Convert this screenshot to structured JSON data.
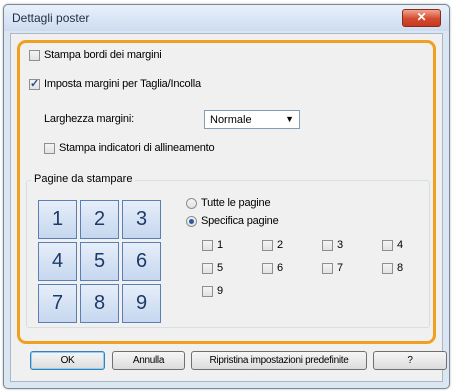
{
  "window": {
    "title": "Dettagli poster",
    "close_label": "✕"
  },
  "options": {
    "print_border_label": "Stampa bordi dei margini",
    "print_border_checked": false,
    "set_margins_label": "Imposta margini per Taglia/Incolla",
    "set_margins_checked": true,
    "margin_width_label": "Larghezza margini:",
    "margin_width_value": "Normale",
    "alignment_label": "Stampa indicatori di allineamento",
    "alignment_checked": false
  },
  "pages_group": {
    "label": "Pagine da stampare",
    "grid": [
      "1",
      "2",
      "3",
      "4",
      "5",
      "6",
      "7",
      "8",
      "9"
    ],
    "radio_all_label": "Tutte le pagine",
    "radio_specific_label": "Specifica pagine",
    "selected_radio": "specific",
    "page_checkboxes": [
      {
        "label": "1",
        "checked": false
      },
      {
        "label": "2",
        "checked": false
      },
      {
        "label": "3",
        "checked": false
      },
      {
        "label": "4",
        "checked": false
      },
      {
        "label": "5",
        "checked": false
      },
      {
        "label": "6",
        "checked": false
      },
      {
        "label": "7",
        "checked": false
      },
      {
        "label": "8",
        "checked": false
      },
      {
        "label": "9",
        "checked": false
      }
    ]
  },
  "buttons": {
    "ok": "OK",
    "cancel": "Annulla",
    "restore_defaults": "Ripristina impostazioni predefinite",
    "help": "?"
  },
  "colors": {
    "highlight": "#f0a020",
    "close_button": "#d2492f",
    "page_cell": "#c6d7ef"
  }
}
